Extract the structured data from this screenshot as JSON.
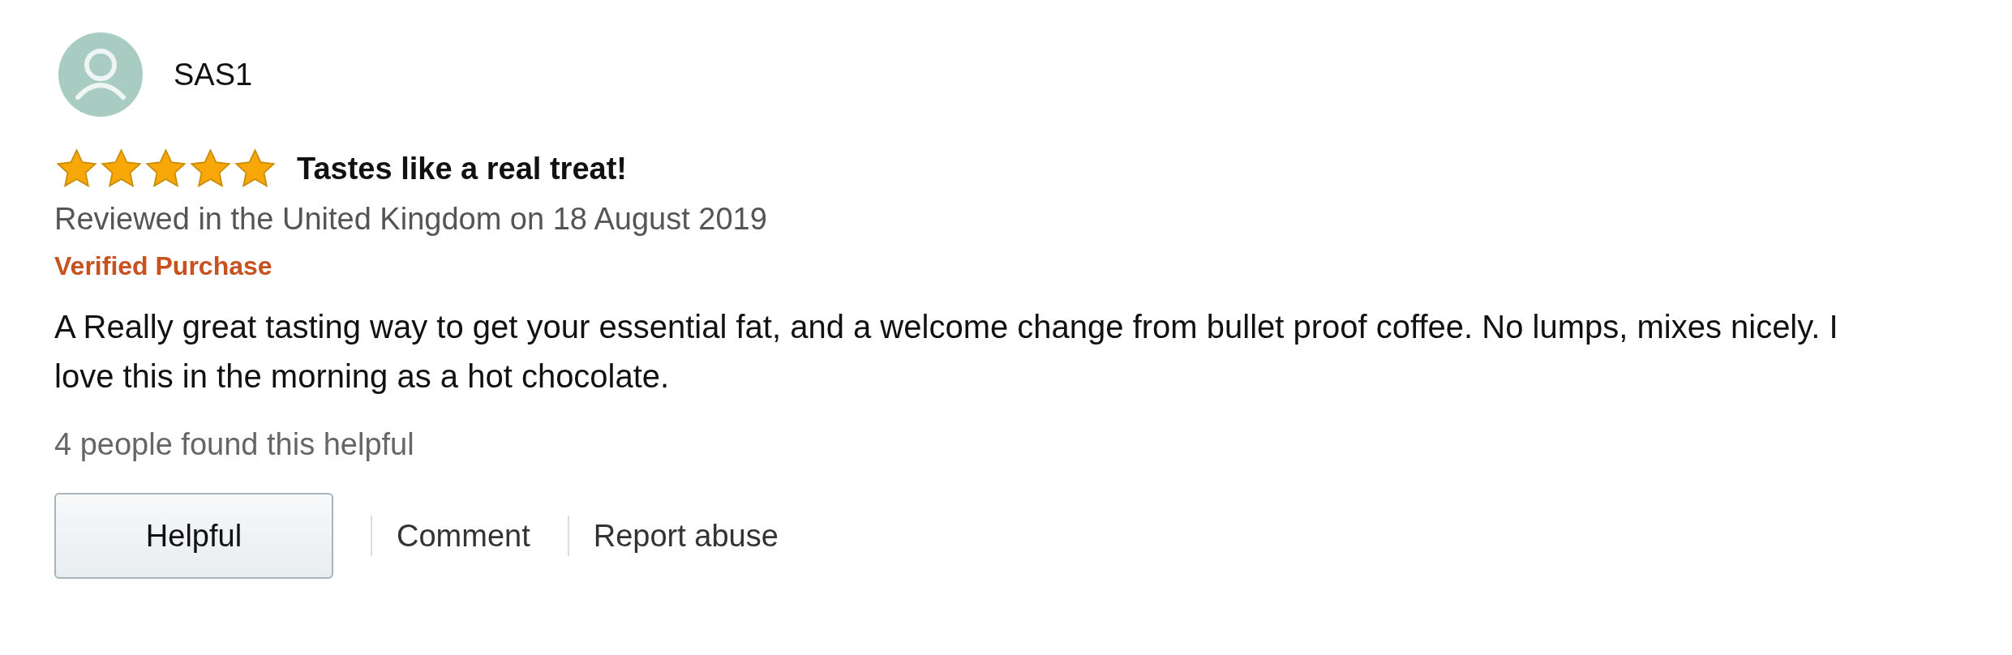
{
  "review": {
    "author": "SAS1",
    "stars": 5,
    "title": "Tastes like a real treat!",
    "meta": "Reviewed in the United Kingdom on 18 August 2019",
    "badge": "Verified Purchase",
    "body": "A Really great tasting way to get your essential fat, and a welcome change from bullet proof coffee. No lumps, mixes nicely. I love this in the morning as a hot chocolate.",
    "helpful_count": "4 people found this helpful"
  },
  "actions": {
    "button": "Helpful",
    "links": [
      "Comment",
      "Report abuse"
    ]
  }
}
